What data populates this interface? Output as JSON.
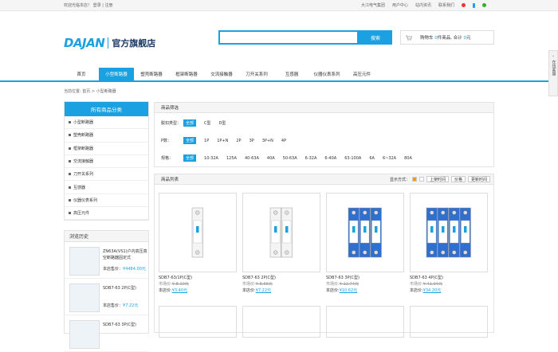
{
  "topbar": {
    "welcome": "欢迎光临本店！",
    "login": "登录",
    "register": "注册",
    "links": [
      "大江电气集团",
      "用户中心",
      "站内资讯",
      "联系我们"
    ]
  },
  "logo": {
    "mark": "DAJAN",
    "text": "官方旗舰店"
  },
  "search": {
    "value": "",
    "button": "搜索"
  },
  "cart": {
    "label": "购物车",
    "count": "0",
    "unit": "件商品, 合计",
    "total": "0",
    "currency": "元"
  },
  "nav": [
    "首页",
    "小型断路器",
    "塑壳断路器",
    "框架断路器",
    "交流接触器",
    "刀开关系列",
    "互感器",
    "仪器仪表系列",
    "高压元件"
  ],
  "breadcrumb": "当前位置: 首页 > 小型断路器",
  "sidebar": {
    "title": "所有商品分类",
    "items": [
      "小型断路器",
      "塑壳断路器",
      "框架断路器",
      "交流接触器",
      "刀开关系列",
      "互感器",
      "仪器仪表系列",
      "高压元件"
    ]
  },
  "history": {
    "title": "浏览历史",
    "items": [
      {
        "name": "ZN63A(VS1)户内高压真空断路器固定式",
        "label": "本店售价：",
        "price": "¥4484.00元"
      },
      {
        "name": "SDB7-63 2P(C型)",
        "label": "本店售价：",
        "price": "¥7.22元"
      },
      {
        "name": "SDB7-63 3P(C型)",
        "label": "",
        "price": ""
      }
    ]
  },
  "filter": {
    "title": "商品筛选",
    "rows": [
      {
        "label": "脱扣类型：",
        "opts": [
          "全部",
          "C型",
          "D型"
        ]
      },
      {
        "label": "P数：",
        "opts": [
          "全部",
          "1P",
          "1P+N",
          "2P",
          "3P",
          "3P+N",
          "4P"
        ]
      },
      {
        "label": "规格：",
        "opts": [
          "全部",
          "10-32A",
          "125A",
          "40-63A",
          "40A",
          "50-63A",
          "6-32A",
          "6-40A",
          "63-100A",
          "6A",
          "6~32A",
          "80A"
        ]
      }
    ]
  },
  "list": {
    "title": "商品列表",
    "view": "显示方式：",
    "sort": [
      "上架时间",
      "价格",
      "更新时间"
    ]
  },
  "products": [
    {
      "name": "SDB7-63/1P(C型)",
      "market_label": "市场价:",
      "market": "¥-8.10元",
      "shop_label": "本店价:",
      "shop": "¥3.40元",
      "poles": 1
    },
    {
      "name": "SDB7-63 2P(C型)",
      "market_label": "市场价:",
      "market": "¥-8.66元",
      "shop_label": "本店价:",
      "shop": "¥7.22元",
      "poles": 2
    },
    {
      "name": "SDB7-63 3P(C型)",
      "market_label": "市场价:",
      "market": "¥-12.74元",
      "shop_label": "本店价:",
      "shop": "¥10.62元",
      "poles": 3
    },
    {
      "name": "SDB7-63 4P(C型)",
      "market_label": "市场价:",
      "market": "¥-41.04元",
      "shop_label": "本店价:",
      "shop": "¥34.20元",
      "poles": 4
    }
  ],
  "float": {
    "text": "在线客服"
  },
  "colors": {
    "accent": "#1ba1e2",
    "brand_text": "#1a3a66"
  }
}
